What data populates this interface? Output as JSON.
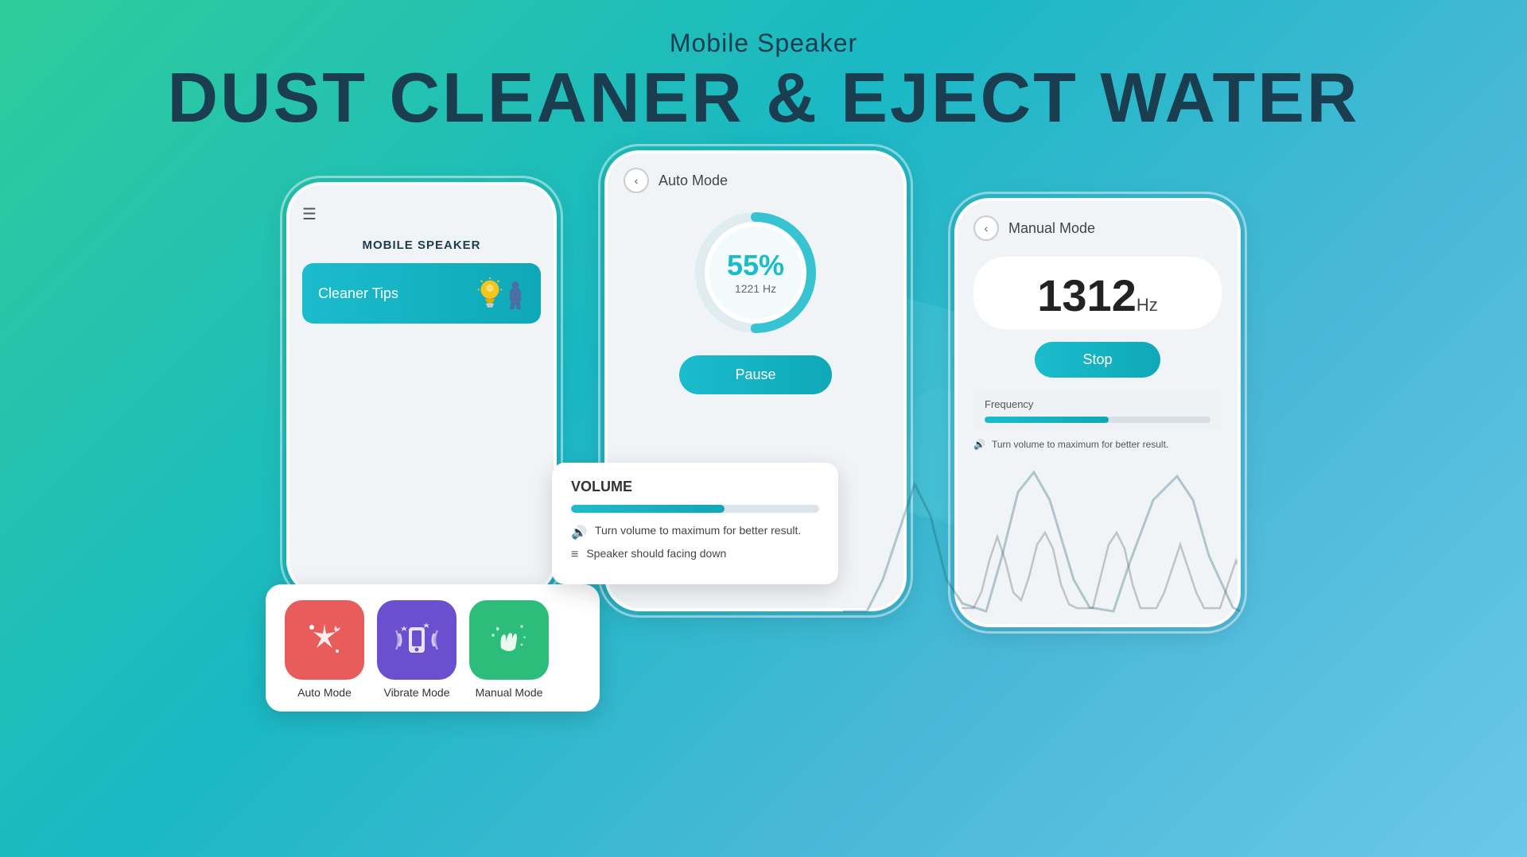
{
  "header": {
    "subtitle": "Mobile Speaker",
    "title": "DUST CLEANER & EJECT WATER"
  },
  "left_phone": {
    "title": "MOBILE SPEAKER",
    "cleaner_tips_label": "Cleaner Tips",
    "mode_cards": [
      {
        "id": "auto",
        "label": "Auto Mode",
        "color": "auto"
      },
      {
        "id": "vibrate",
        "label": "Vibrate Mode",
        "color": "vibrate"
      },
      {
        "id": "manual",
        "label": "Manual Mode",
        "color": "manual"
      }
    ]
  },
  "center_phone": {
    "mode_title": "Auto Mode",
    "back_label": "<",
    "progress_percent": "55%",
    "progress_hz": "1221 Hz",
    "pause_label": "Pause",
    "volume_section": {
      "label": "VOLUME",
      "fill_percent": 62,
      "tips": [
        "Turn volume to maximum for better result.",
        "Speaker should facing down"
      ]
    }
  },
  "right_phone": {
    "mode_title": "Manual Mode",
    "back_label": "<",
    "frequency_value": "1312",
    "frequency_unit": "Hz",
    "stop_label": "Stop",
    "freq_section_label": "Frequency",
    "freq_fill_percent": 55,
    "freq_tip": "Turn volume to maximum for better result.",
    "volume_icon": "🔊"
  }
}
